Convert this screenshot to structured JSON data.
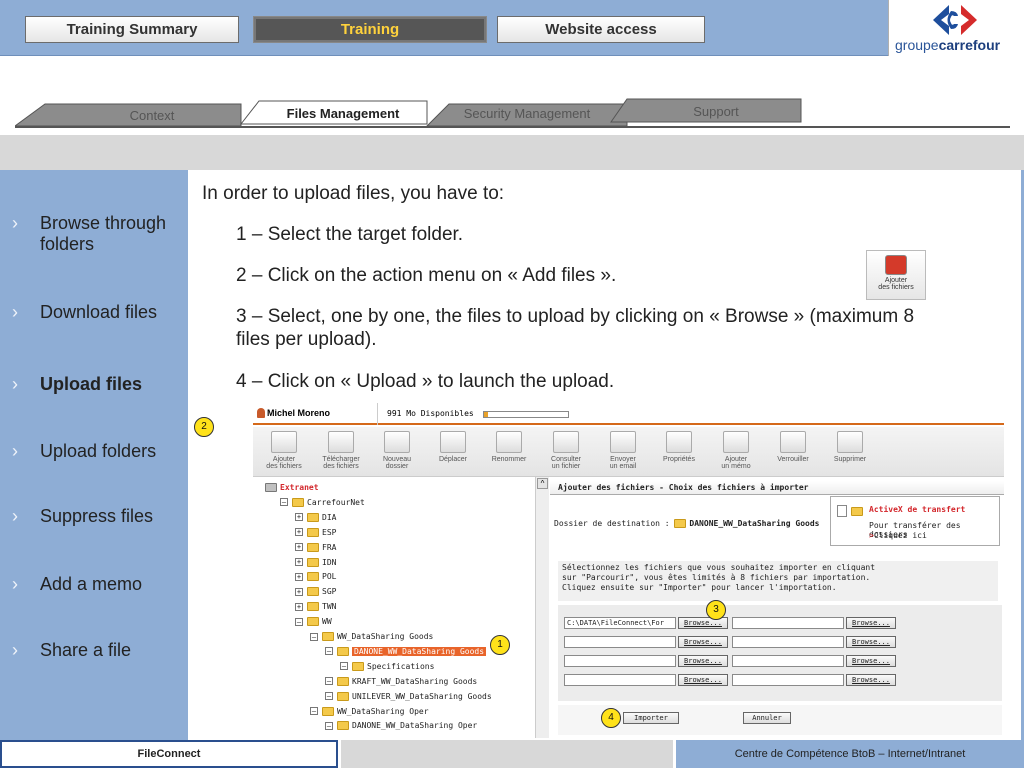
{
  "header": {
    "tabs": [
      "Training Summary",
      "Training",
      "Website access"
    ],
    "active_tab": "Training",
    "logo_prefix": "groupe",
    "logo_brand": "carrefour"
  },
  "subtabs": {
    "items": [
      "Context",
      "Files Management",
      "Security Management",
      "Support"
    ],
    "active": "Files Management"
  },
  "sidebar": {
    "items": [
      "Browse through folders",
      "Download files",
      "Upload files",
      "Upload folders",
      "Suppress files",
      "Add a memo",
      "Share a file"
    ],
    "active": "Upload files",
    "chevron": "›"
  },
  "content": {
    "intro": "In order to upload files, you have to:",
    "steps": [
      "1 – Select the target folder.",
      "2 – Click on the action menu on « Add files ».",
      "3 – Select, one by one, the files to upload by clicking on « Browse » (maximum 8 files per upload).",
      "4 – Click on « Upload » to launch the upload."
    ],
    "add_files_icon_label_1": "Ajouter",
    "add_files_icon_label_2": "des fichiers"
  },
  "screenshot": {
    "user": "Michel Moreno",
    "space": "991 Mo Disponibles",
    "toolbar": [
      [
        "Ajouter",
        "des fichiers"
      ],
      [
        "Télécharger",
        "des fichiers"
      ],
      [
        "Nouveau",
        "dossier"
      ],
      [
        "Déplacer",
        ""
      ],
      [
        "Renommer",
        ""
      ],
      [
        "Consulter",
        "un fichier"
      ],
      [
        "Envoyer",
        "un email"
      ],
      [
        "Propriétés",
        ""
      ],
      [
        "Ajouter",
        "un mémo"
      ],
      [
        "Verrouiller",
        ""
      ],
      [
        "Supprimer",
        ""
      ]
    ],
    "tree": [
      {
        "label": "Extranet",
        "level": 0,
        "pm": ""
      },
      {
        "label": "CarrefourNet",
        "level": 1,
        "pm": "⊟"
      },
      {
        "label": "DIA",
        "level": 2,
        "pm": "⊞"
      },
      {
        "label": "ESP",
        "level": 2,
        "pm": "⊞"
      },
      {
        "label": "FRA",
        "level": 2,
        "pm": "⊞"
      },
      {
        "label": "IDN",
        "level": 2,
        "pm": "⊞"
      },
      {
        "label": "POL",
        "level": 2,
        "pm": "⊞"
      },
      {
        "label": "SGP",
        "level": 2,
        "pm": "⊞"
      },
      {
        "label": "TWN",
        "level": 2,
        "pm": "⊞"
      },
      {
        "label": "WW",
        "level": 2,
        "pm": "⊟"
      },
      {
        "label": "WW_DataSharing Goods",
        "level": 3,
        "pm": "⊟"
      },
      {
        "label": "DANONE_WW_DataSharing Goods",
        "level": 4,
        "pm": "⊟",
        "selected": true
      },
      {
        "label": "Specifications",
        "level": 5,
        "pm": "⊟"
      },
      {
        "label": "KRAFT_WW_DataSharing Goods",
        "level": 4,
        "pm": "⊟"
      },
      {
        "label": "UNILEVER_WW_DataSharing Goods",
        "level": 4,
        "pm": "⊟"
      },
      {
        "label": "WW_DataSharing Oper",
        "level": 3,
        "pm": "⊟"
      },
      {
        "label": "DANONE_WW_DataSharing Oper",
        "level": 4,
        "pm": "⊟"
      }
    ],
    "form_title": "Ajouter des fichiers - Choix des fichiers à importer",
    "dest_label": "Dossier de destination :",
    "dest_value": "DANONE_WW_DataSharing Goods",
    "activex_title": "ActiveX de transfert",
    "activex_line1": "Pour transférer des dossiers",
    "activex_line2": "Cliquez ici",
    "activex_arrow": ">",
    "instr_1": "Sélectionnez les fichiers que vous souhaitez importer en cliquant",
    "instr_2": "sur \"Parcourir\", vous êtes limités à 8 fichiers par importation.",
    "instr_3": "Cliquez ensuite sur \"Importer\" pour lancer l'importation.",
    "first_file": "C:\\DATA\\FileConnect\\For",
    "browse": "Browse...",
    "import": "Importer",
    "cancel": "Annuler",
    "badges": [
      "1",
      "2",
      "3",
      "4"
    ]
  },
  "footer": {
    "left": "FileConnect",
    "right": "Centre de Compétence BtoB – Internet/Intranet"
  },
  "colors": {
    "bar_blue": "#8eadd5",
    "highlight_orange": "#e8642a",
    "badge_yellow": "#ffe21a",
    "active_tab_text": "#ffd23c"
  }
}
